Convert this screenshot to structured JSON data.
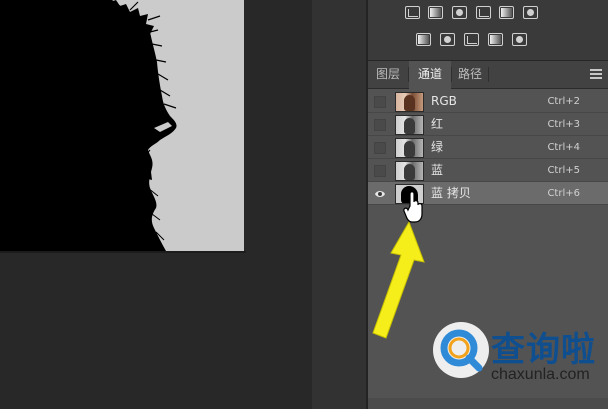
{
  "tabs": [
    {
      "label": "图层"
    },
    {
      "label": "通道"
    },
    {
      "label": "路径"
    }
  ],
  "active_tab": "通道",
  "adjustment_icons": {
    "row1": [
      "levels-icon",
      "balance-icon",
      "black-white-icon",
      "photo-filter-icon",
      "channel-mixer-icon",
      "color-lookup-icon"
    ],
    "row2": [
      "invert-icon",
      "posterize-icon",
      "threshold-icon",
      "selective-color-icon",
      "gradient-map-icon"
    ]
  },
  "channels": [
    {
      "name": "RGB",
      "shortcut": "Ctrl+2",
      "thumb": "color",
      "visible": false,
      "selected": false
    },
    {
      "name": "红",
      "shortcut": "Ctrl+3",
      "thumb": "gray",
      "visible": false,
      "selected": false
    },
    {
      "name": "绿",
      "shortcut": "Ctrl+4",
      "thumb": "gray",
      "visible": false,
      "selected": false
    },
    {
      "name": "蓝",
      "shortcut": "Ctrl+5",
      "thumb": "gray",
      "visible": false,
      "selected": false
    },
    {
      "name": "蓝 拷贝",
      "shortcut": "Ctrl+6",
      "thumb": "mask",
      "visible": true,
      "selected": true
    }
  ],
  "watermark": {
    "brand": "查询啦",
    "domain": "chaxunla.com"
  },
  "colors": {
    "arrow": "#f5ee1b",
    "selected_row": "#6b6b6b",
    "panel": "#535353",
    "brand": "#0f4f8f"
  }
}
